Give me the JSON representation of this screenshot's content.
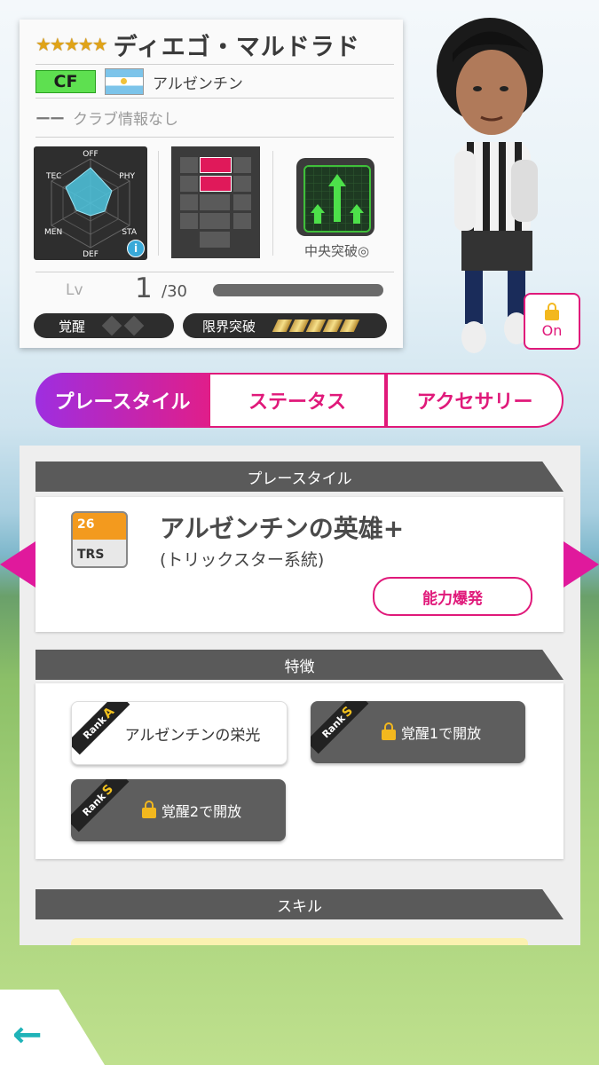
{
  "player": {
    "stars": "★★★★★",
    "name": "ディエゴ・マルドラド",
    "position": "CF",
    "country": "アルゼンチン",
    "club_dash": "ーー",
    "club": "クラブ情報なし",
    "radar_labels": {
      "off": "OFF",
      "tec": "TEC",
      "phy": "PHY",
      "men": "MEN",
      "sta": "STA",
      "def": "DEF"
    },
    "tactic_label": "中央突破◎",
    "level_label": "Lv",
    "level": "1",
    "level_max": "/30",
    "level_progress": 0,
    "awaken_label": "覚醒",
    "limit_label": "限界突破"
  },
  "lock": {
    "label": "On",
    "icon": "padlock-icon"
  },
  "tabs": [
    "プレースタイル",
    "ステータス",
    "アクセサリー"
  ],
  "playstyle": {
    "header": "プレースタイル",
    "icon_num": "26",
    "icon_tag": "TRS",
    "name": "アルゼンチンの英雄+",
    "sub": "(トリックスター系統)",
    "button": "能力爆発"
  },
  "traits": {
    "header": "特徴",
    "rank_prefix": "Rank",
    "items": [
      {
        "rank": "A",
        "text": "アルゼンチンの栄光"
      },
      {
        "rank": "S",
        "text": "覚醒1で開放"
      },
      {
        "rank": "S",
        "text": "覚醒2で開放"
      }
    ]
  },
  "skills": {
    "header": "スキル"
  },
  "colors": {
    "accent": "#e0197a",
    "position_badge": "#5ee050",
    "back_arrow": "#1fb3b8"
  }
}
